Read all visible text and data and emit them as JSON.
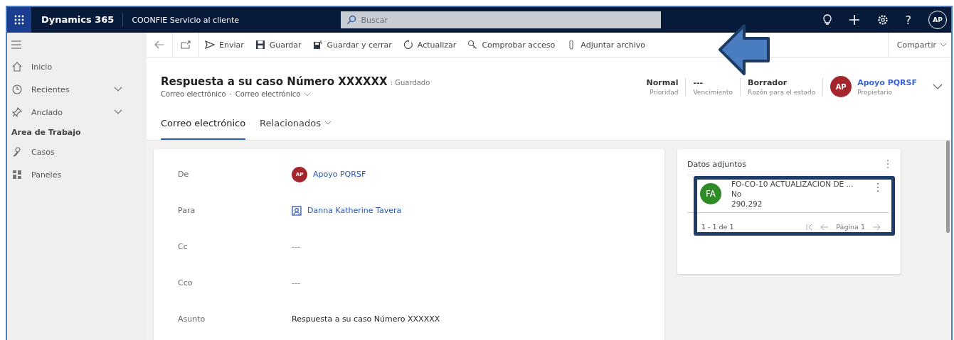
{
  "topbar": {
    "app_name": "Dynamics 365",
    "area": "COONFIE Servicio al cliente",
    "search": {
      "placeholder": "Buscar"
    },
    "help": "?",
    "avatar": "AP"
  },
  "toolbar": {
    "buttons": [
      {
        "label": "Enviar",
        "kind": "send"
      },
      {
        "label": "Guardar",
        "kind": "save"
      },
      {
        "label": "Guardar y cerrar",
        "kind": "saveclose"
      },
      {
        "label": "Actualizar",
        "kind": "refresh"
      },
      {
        "label": "Comprobar acceso",
        "kind": "access"
      },
      {
        "label": "Adjuntar archivo",
        "kind": "attach"
      }
    ],
    "share": "Compartir"
  },
  "sidebar": {
    "items": [
      {
        "label": "Inicio",
        "kind": "home",
        "expandable": false,
        "selected": false
      },
      {
        "label": "Recientes",
        "kind": "recent",
        "expandable": true,
        "selected": false
      },
      {
        "label": "Anclado",
        "kind": "pin",
        "expandable": true,
        "selected": false
      }
    ],
    "section": "Area de Trabajo",
    "section_items": [
      {
        "label": "Casos",
        "kind": "wrench",
        "selected": false
      },
      {
        "label": "Paneles",
        "kind": "dashboard",
        "selected": false
      }
    ]
  },
  "record": {
    "title": "Respuesta a su caso Número XXXXXX",
    "status": ": Guardado",
    "breadcrumb": [
      "Correo electrónico",
      "Correo electrónico"
    ],
    "breadcrumb_separator": "·",
    "fields": [
      {
        "value": "Normal",
        "label": "Prioridad"
      },
      {
        "value": "---",
        "label": "Vencimiento"
      },
      {
        "value": "Borrador",
        "label": "Razón para el estado"
      }
    ],
    "owner": {
      "initials": "AP",
      "name": "Apoyo PQRSF",
      "label": "Propietario"
    }
  },
  "tabs": [
    {
      "label": "Correo electrónico",
      "selected": true,
      "dropdown": false
    },
    {
      "label": "Relacionados",
      "selected": false,
      "dropdown": true
    }
  ],
  "form": [
    {
      "label": "De",
      "kind": "user",
      "initials": "AP",
      "value": "Apoyo PQRSF"
    },
    {
      "label": "Para",
      "kind": "contact",
      "value": "Danna Katherine Tavera"
    },
    {
      "label": "Cc",
      "kind": "empty",
      "value": "---"
    },
    {
      "label": "Cco",
      "kind": "empty",
      "value": "---"
    },
    {
      "label": "Asunto",
      "kind": "text",
      "value": "Respuesta a su caso Número XXXXXX"
    }
  ],
  "attachments": {
    "title": "Datos adjuntos",
    "items": [
      {
        "initials": "FA",
        "color": "#2e8b26",
        "name": "FO-CO-10 ACTUALIZACION DE ...",
        "line2": "No",
        "line3": "290.292"
      }
    ],
    "count": "1 - 1 de 1",
    "page": "Página 1"
  }
}
